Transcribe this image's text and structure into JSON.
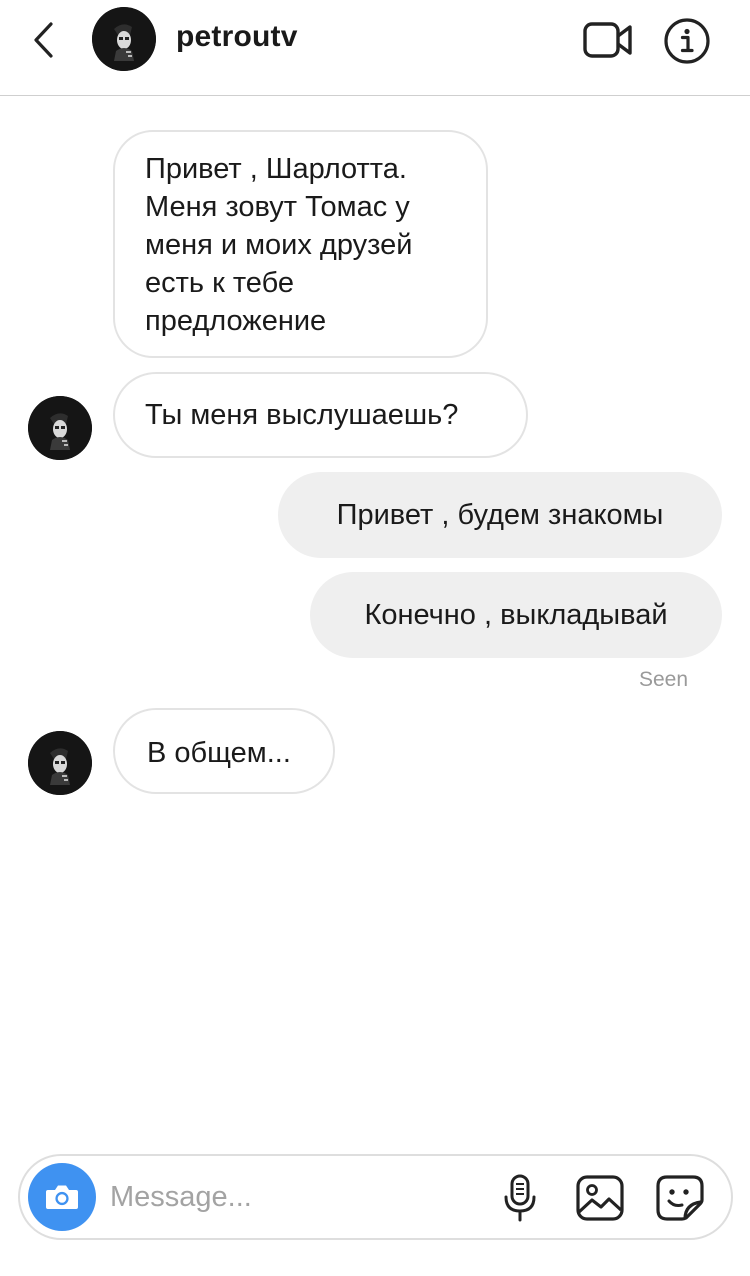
{
  "header": {
    "username": "petroutv",
    "back_icon": "chevron-left-icon",
    "video_icon": "video-camera-icon",
    "info_icon": "info-icon"
  },
  "messages": [
    {
      "direction": "incoming",
      "lines": [
        "Привет , Шарлотта.",
        "Меня зовут Томас у",
        "меня и моих друзей",
        "есть к тебе",
        "предложение"
      ]
    },
    {
      "direction": "incoming",
      "text": "Ты меня выслушаешь?"
    },
    {
      "direction": "outgoing",
      "text": "Привет , будем знакомы"
    },
    {
      "direction": "outgoing",
      "text": "Конечно , выкладывай"
    },
    {
      "direction": "incoming",
      "text": "В общем..."
    }
  ],
  "seen_label": "Seen",
  "composer": {
    "placeholder": "Message...",
    "value": "",
    "camera_icon": "camera-icon",
    "mic_icon": "microphone-icon",
    "gallery_icon": "image-gallery-icon",
    "sticker_icon": "sticker-icon"
  },
  "colors": {
    "accent_blue": "#3f92f1",
    "outgoing_bubble": "#efefef",
    "incoming_border": "#e3e3e3",
    "seen_text": "#9a9a9a"
  }
}
